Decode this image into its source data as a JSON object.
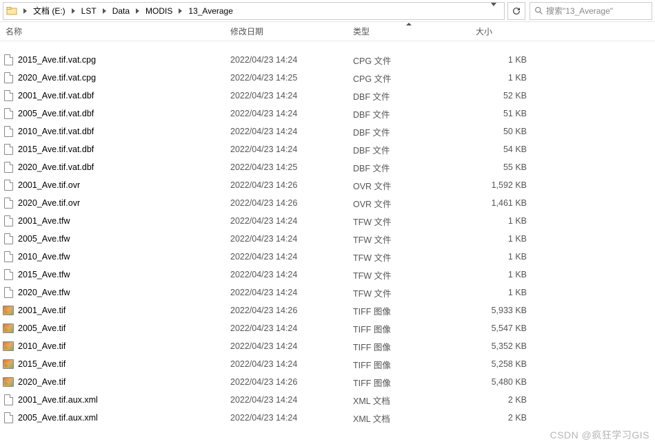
{
  "breadcrumb": {
    "items": [
      "文档 (E:)",
      "LST",
      "Data",
      "MODIS",
      "13_Average"
    ]
  },
  "search": {
    "placeholder": "搜索\"13_Average\""
  },
  "headers": {
    "name": "名称",
    "date": "修改日期",
    "type": "类型",
    "size": "大小"
  },
  "files": [
    {
      "name": "2015_Ave.tif.vat.cpg",
      "date": "2022/04/23 14:24",
      "type": "CPG 文件",
      "size": "1 KB",
      "icon": "file"
    },
    {
      "name": "2020_Ave.tif.vat.cpg",
      "date": "2022/04/23 14:25",
      "type": "CPG 文件",
      "size": "1 KB",
      "icon": "file"
    },
    {
      "name": "2001_Ave.tif.vat.dbf",
      "date": "2022/04/23 14:24",
      "type": "DBF 文件",
      "size": "52 KB",
      "icon": "file"
    },
    {
      "name": "2005_Ave.tif.vat.dbf",
      "date": "2022/04/23 14:24",
      "type": "DBF 文件",
      "size": "51 KB",
      "icon": "file"
    },
    {
      "name": "2010_Ave.tif.vat.dbf",
      "date": "2022/04/23 14:24",
      "type": "DBF 文件",
      "size": "50 KB",
      "icon": "file"
    },
    {
      "name": "2015_Ave.tif.vat.dbf",
      "date": "2022/04/23 14:24",
      "type": "DBF 文件",
      "size": "54 KB",
      "icon": "file"
    },
    {
      "name": "2020_Ave.tif.vat.dbf",
      "date": "2022/04/23 14:25",
      "type": "DBF 文件",
      "size": "55 KB",
      "icon": "file"
    },
    {
      "name": "2001_Ave.tif.ovr",
      "date": "2022/04/23 14:26",
      "type": "OVR 文件",
      "size": "1,592 KB",
      "icon": "file"
    },
    {
      "name": "2020_Ave.tif.ovr",
      "date": "2022/04/23 14:26",
      "type": "OVR 文件",
      "size": "1,461 KB",
      "icon": "file"
    },
    {
      "name": "2001_Ave.tfw",
      "date": "2022/04/23 14:24",
      "type": "TFW 文件",
      "size": "1 KB",
      "icon": "file"
    },
    {
      "name": "2005_Ave.tfw",
      "date": "2022/04/23 14:24",
      "type": "TFW 文件",
      "size": "1 KB",
      "icon": "file"
    },
    {
      "name": "2010_Ave.tfw",
      "date": "2022/04/23 14:24",
      "type": "TFW 文件",
      "size": "1 KB",
      "icon": "file"
    },
    {
      "name": "2015_Ave.tfw",
      "date": "2022/04/23 14:24",
      "type": "TFW 文件",
      "size": "1 KB",
      "icon": "file"
    },
    {
      "name": "2020_Ave.tfw",
      "date": "2022/04/23 14:24",
      "type": "TFW 文件",
      "size": "1 KB",
      "icon": "file"
    },
    {
      "name": "2001_Ave.tif",
      "date": "2022/04/23 14:26",
      "type": "TIFF 图像",
      "size": "5,933 KB",
      "icon": "tif"
    },
    {
      "name": "2005_Ave.tif",
      "date": "2022/04/23 14:24",
      "type": "TIFF 图像",
      "size": "5,547 KB",
      "icon": "tif"
    },
    {
      "name": "2010_Ave.tif",
      "date": "2022/04/23 14:24",
      "type": "TIFF 图像",
      "size": "5,352 KB",
      "icon": "tif"
    },
    {
      "name": "2015_Ave.tif",
      "date": "2022/04/23 14:24",
      "type": "TIFF 图像",
      "size": "5,258 KB",
      "icon": "tif"
    },
    {
      "name": "2020_Ave.tif",
      "date": "2022/04/23 14:26",
      "type": "TIFF 图像",
      "size": "5,480 KB",
      "icon": "tif"
    },
    {
      "name": "2001_Ave.tif.aux.xml",
      "date": "2022/04/23 14:24",
      "type": "XML 文档",
      "size": "2 KB",
      "icon": "file"
    },
    {
      "name": "2005_Ave.tif.aux.xml",
      "date": "2022/04/23 14:24",
      "type": "XML 文档",
      "size": "2 KB",
      "icon": "file"
    }
  ],
  "watermark": "CSDN @疯狂学习GIS"
}
